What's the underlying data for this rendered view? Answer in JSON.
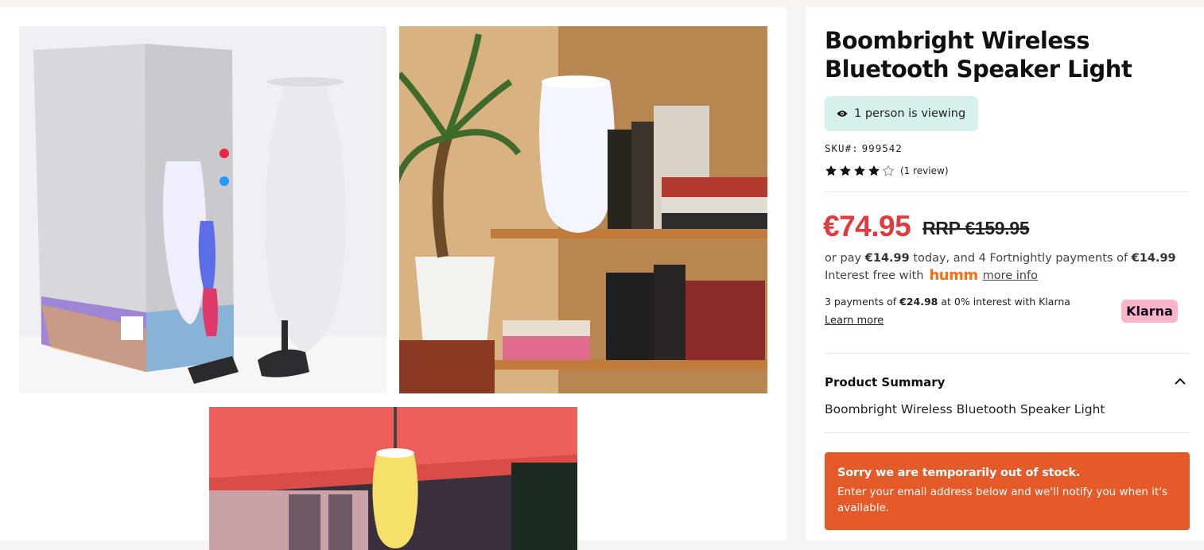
{
  "gallery": {
    "images": [
      {
        "alt": "Boombright box and speaker"
      },
      {
        "alt": "Speaker light on bookshelf"
      },
      {
        "alt": "Speaker light under umbrella"
      }
    ]
  },
  "product": {
    "title": "Boombright Wireless Bluetooth Speaker Light",
    "viewing": "1 person is viewing",
    "sku_label": "SKU#:",
    "sku": "999542",
    "rating": 4,
    "rating_max": 5,
    "reviews": "(1 review)",
    "price": "€74.95",
    "rrp": "RRP €159.95"
  },
  "humm": {
    "prefix": "or pay",
    "today_amount": "€14.99",
    "middle": "today, and 4 Fortnightly payments of",
    "installment": "€14.99",
    "interest_free": "Interest free with",
    "logo": "humm",
    "more_info": "more info"
  },
  "klarna": {
    "prefix": "3 payments of",
    "amount": "€24.98",
    "suffix": "at 0% interest with Klarna",
    "learn_more": "Learn more",
    "badge": "Klarna"
  },
  "summary": {
    "heading": "Product Summary",
    "text": "Boombright Wireless Bluetooth Speaker Light"
  },
  "stock": {
    "heading": "Sorry we are temporarily out of stock.",
    "message": "Enter your email address below and we'll notify you when it's available."
  },
  "colors": {
    "price": "#e03a3e",
    "viewing_bg": "#d6f1ec",
    "humm": "#ff6c0e",
    "klarna_badge": "#ffb3c7",
    "out_of_stock": "#e45a29"
  }
}
